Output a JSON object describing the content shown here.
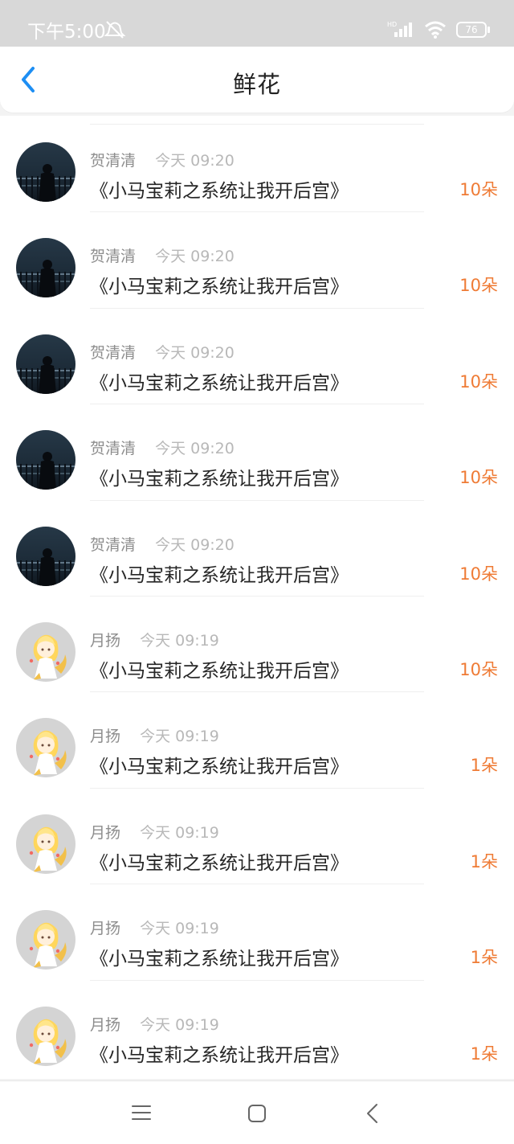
{
  "status_bar": {
    "time": "下午5:00",
    "battery": "76"
  },
  "header": {
    "title": "鲜花"
  },
  "colors": {
    "accent_blue": "#1d8ef3",
    "count_orange": "#ef7b35"
  },
  "items": [
    {
      "user": "贺清清",
      "time": "今天 09:20",
      "book": "《小马宝莉之系统让我开后宫》",
      "count": "10朵",
      "avatar": "dark-night-avatar"
    },
    {
      "user": "贺清清",
      "time": "今天 09:20",
      "book": "《小马宝莉之系统让我开后宫》",
      "count": "10朵",
      "avatar": "dark-night-avatar"
    },
    {
      "user": "贺清清",
      "time": "今天 09:20",
      "book": "《小马宝莉之系统让我开后宫》",
      "count": "10朵",
      "avatar": "dark-night-avatar"
    },
    {
      "user": "贺清清",
      "time": "今天 09:20",
      "book": "《小马宝莉之系统让我开后宫》",
      "count": "10朵",
      "avatar": "dark-night-avatar"
    },
    {
      "user": "贺清清",
      "time": "今天 09:20",
      "book": "《小马宝莉之系统让我开后宫》",
      "count": "10朵",
      "avatar": "dark-night-avatar"
    },
    {
      "user": "月扬",
      "time": "今天 09:19",
      "book": "《小马宝莉之系统让我开后宫》",
      "count": "10朵",
      "avatar": "anime-girl-avatar"
    },
    {
      "user": "月扬",
      "time": "今天 09:19",
      "book": "《小马宝莉之系统让我开后宫》",
      "count": "1朵",
      "avatar": "anime-girl-avatar"
    },
    {
      "user": "月扬",
      "time": "今天 09:19",
      "book": "《小马宝莉之系统让我开后宫》",
      "count": "1朵",
      "avatar": "anime-girl-avatar"
    },
    {
      "user": "月扬",
      "time": "今天 09:19",
      "book": "《小马宝莉之系统让我开后宫》",
      "count": "1朵",
      "avatar": "anime-girl-avatar"
    },
    {
      "user": "月扬",
      "time": "今天 09:19",
      "book": "《小马宝莉之系统让我开后宫》",
      "count": "1朵",
      "avatar": "anime-girl-avatar"
    }
  ],
  "icons": {
    "back": "chevron-left-icon",
    "menu": "menu-icon",
    "home": "home-square-icon",
    "system_back": "chevron-left-icon"
  }
}
